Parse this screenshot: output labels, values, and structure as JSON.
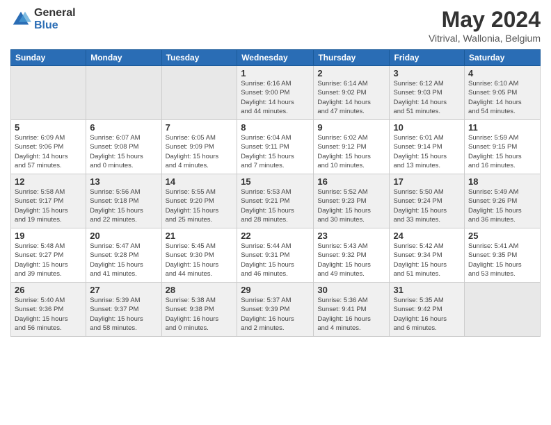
{
  "logo": {
    "general": "General",
    "blue": "Blue"
  },
  "title": "May 2024",
  "subtitle": "Vitrival, Wallonia, Belgium",
  "weekdays": [
    "Sunday",
    "Monday",
    "Tuesday",
    "Wednesday",
    "Thursday",
    "Friday",
    "Saturday"
  ],
  "weeks": [
    [
      {
        "day": "",
        "info": ""
      },
      {
        "day": "",
        "info": ""
      },
      {
        "day": "",
        "info": ""
      },
      {
        "day": "1",
        "info": "Sunrise: 6:16 AM\nSunset: 9:00 PM\nDaylight: 14 hours\nand 44 minutes."
      },
      {
        "day": "2",
        "info": "Sunrise: 6:14 AM\nSunset: 9:02 PM\nDaylight: 14 hours\nand 47 minutes."
      },
      {
        "day": "3",
        "info": "Sunrise: 6:12 AM\nSunset: 9:03 PM\nDaylight: 14 hours\nand 51 minutes."
      },
      {
        "day": "4",
        "info": "Sunrise: 6:10 AM\nSunset: 9:05 PM\nDaylight: 14 hours\nand 54 minutes."
      }
    ],
    [
      {
        "day": "5",
        "info": "Sunrise: 6:09 AM\nSunset: 9:06 PM\nDaylight: 14 hours\nand 57 minutes."
      },
      {
        "day": "6",
        "info": "Sunrise: 6:07 AM\nSunset: 9:08 PM\nDaylight: 15 hours\nand 0 minutes."
      },
      {
        "day": "7",
        "info": "Sunrise: 6:05 AM\nSunset: 9:09 PM\nDaylight: 15 hours\nand 4 minutes."
      },
      {
        "day": "8",
        "info": "Sunrise: 6:04 AM\nSunset: 9:11 PM\nDaylight: 15 hours\nand 7 minutes."
      },
      {
        "day": "9",
        "info": "Sunrise: 6:02 AM\nSunset: 9:12 PM\nDaylight: 15 hours\nand 10 minutes."
      },
      {
        "day": "10",
        "info": "Sunrise: 6:01 AM\nSunset: 9:14 PM\nDaylight: 15 hours\nand 13 minutes."
      },
      {
        "day": "11",
        "info": "Sunrise: 5:59 AM\nSunset: 9:15 PM\nDaylight: 15 hours\nand 16 minutes."
      }
    ],
    [
      {
        "day": "12",
        "info": "Sunrise: 5:58 AM\nSunset: 9:17 PM\nDaylight: 15 hours\nand 19 minutes."
      },
      {
        "day": "13",
        "info": "Sunrise: 5:56 AM\nSunset: 9:18 PM\nDaylight: 15 hours\nand 22 minutes."
      },
      {
        "day": "14",
        "info": "Sunrise: 5:55 AM\nSunset: 9:20 PM\nDaylight: 15 hours\nand 25 minutes."
      },
      {
        "day": "15",
        "info": "Sunrise: 5:53 AM\nSunset: 9:21 PM\nDaylight: 15 hours\nand 28 minutes."
      },
      {
        "day": "16",
        "info": "Sunrise: 5:52 AM\nSunset: 9:23 PM\nDaylight: 15 hours\nand 30 minutes."
      },
      {
        "day": "17",
        "info": "Sunrise: 5:50 AM\nSunset: 9:24 PM\nDaylight: 15 hours\nand 33 minutes."
      },
      {
        "day": "18",
        "info": "Sunrise: 5:49 AM\nSunset: 9:26 PM\nDaylight: 15 hours\nand 36 minutes."
      }
    ],
    [
      {
        "day": "19",
        "info": "Sunrise: 5:48 AM\nSunset: 9:27 PM\nDaylight: 15 hours\nand 39 minutes."
      },
      {
        "day": "20",
        "info": "Sunrise: 5:47 AM\nSunset: 9:28 PM\nDaylight: 15 hours\nand 41 minutes."
      },
      {
        "day": "21",
        "info": "Sunrise: 5:45 AM\nSunset: 9:30 PM\nDaylight: 15 hours\nand 44 minutes."
      },
      {
        "day": "22",
        "info": "Sunrise: 5:44 AM\nSunset: 9:31 PM\nDaylight: 15 hours\nand 46 minutes."
      },
      {
        "day": "23",
        "info": "Sunrise: 5:43 AM\nSunset: 9:32 PM\nDaylight: 15 hours\nand 49 minutes."
      },
      {
        "day": "24",
        "info": "Sunrise: 5:42 AM\nSunset: 9:34 PM\nDaylight: 15 hours\nand 51 minutes."
      },
      {
        "day": "25",
        "info": "Sunrise: 5:41 AM\nSunset: 9:35 PM\nDaylight: 15 hours\nand 53 minutes."
      }
    ],
    [
      {
        "day": "26",
        "info": "Sunrise: 5:40 AM\nSunset: 9:36 PM\nDaylight: 15 hours\nand 56 minutes."
      },
      {
        "day": "27",
        "info": "Sunrise: 5:39 AM\nSunset: 9:37 PM\nDaylight: 15 hours\nand 58 minutes."
      },
      {
        "day": "28",
        "info": "Sunrise: 5:38 AM\nSunset: 9:38 PM\nDaylight: 16 hours\nand 0 minutes."
      },
      {
        "day": "29",
        "info": "Sunrise: 5:37 AM\nSunset: 9:39 PM\nDaylight: 16 hours\nand 2 minutes."
      },
      {
        "day": "30",
        "info": "Sunrise: 5:36 AM\nSunset: 9:41 PM\nDaylight: 16 hours\nand 4 minutes."
      },
      {
        "day": "31",
        "info": "Sunrise: 5:35 AM\nSunset: 9:42 PM\nDaylight: 16 hours\nand 6 minutes."
      },
      {
        "day": "",
        "info": ""
      }
    ]
  ]
}
